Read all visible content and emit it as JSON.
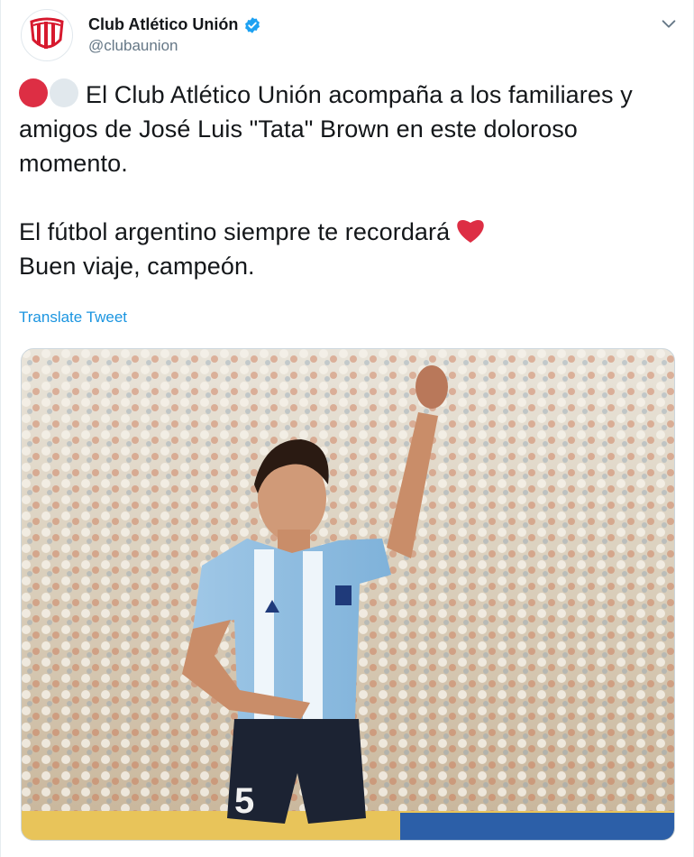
{
  "account": {
    "display_name": "Club Atlético Unión",
    "handle": "@clubaunion",
    "verified": true
  },
  "tweet": {
    "line1": "El Club Atlético Unión acompaña a los familiares y amigos de José Luis \"Tata\" Brown en este doloroso momento.",
    "line2": "El fútbol argentino siempre te recordará",
    "line3": "Buen viaje, campeón."
  },
  "translate_label": "Translate Tweet",
  "media": {
    "shirt_number": "5"
  },
  "colors": {
    "brand_blue": "#1da1f2",
    "link": "#1b95e0",
    "red_circle": "#dd2e44",
    "white_circle": "#e1e8ed",
    "heart": "#dd2e44"
  },
  "icons": [
    "avatar-club-crest-icon",
    "verified-badge-icon",
    "chevron-down-icon",
    "red-circle-emoji-icon",
    "white-circle-emoji-icon",
    "red-heart-emoji-icon"
  ]
}
